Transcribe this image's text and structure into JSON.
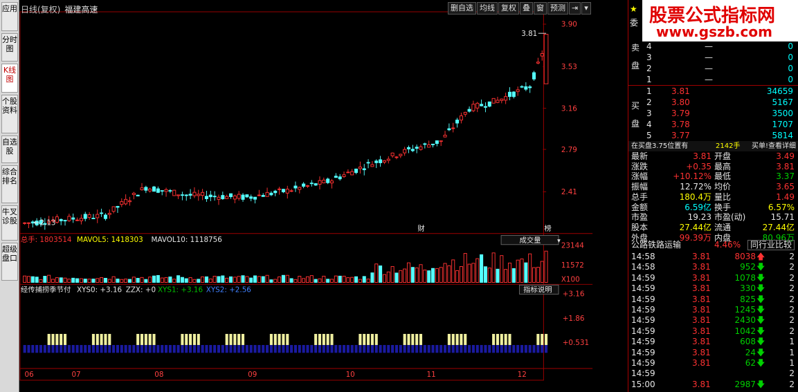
{
  "left_tabs": [
    {
      "label": "应用",
      "active": false
    },
    {
      "label": "分时图",
      "active": false
    },
    {
      "label": "K线图",
      "active": true
    },
    {
      "label": "个股资料",
      "active": false
    },
    {
      "label": "自选股",
      "active": false
    },
    {
      "label": "综合排名",
      "active": false
    },
    {
      "label": "牛叉诊股",
      "active": false
    },
    {
      "label": "超级盘口",
      "active": false
    }
  ],
  "header": {
    "period": "日线(复权)",
    "stock_name": "福建高速",
    "toolbar": [
      "删自选",
      "均线",
      "复权",
      "叠",
      "窗",
      "预测"
    ],
    "arrow_icon": "⇥",
    "menu_icon": "▾"
  },
  "price_chart": {
    "y_ticks": [
      "3.90",
      "3.53",
      "3.16",
      "2.79",
      "2.41"
    ],
    "high_marker": "3.81",
    "low_marker": "2.13",
    "event_labels": [
      "财",
      "榜"
    ]
  },
  "volume_panel": {
    "label_total": "总手: 1803514",
    "label_ma5": "MAVOL5: 1418303",
    "label_ma10": "MAVOL10: 1118756",
    "selector": "成交量",
    "y_ticks": [
      "23144",
      "11572"
    ],
    "unit": "X100"
  },
  "indicator_panel": {
    "name": "经传捕捞季节付",
    "xys0": "XYS0: +3.16",
    "zzx": "ZZX: +0",
    "xys1": "XYS1: +3.16",
    "xys2": "XYS2: +2.56",
    "help_button": "指标说明",
    "y_ticks": [
      "+3.16",
      "+1.86",
      "+0.531"
    ]
  },
  "x_axis": [
    "06",
    "07",
    "08",
    "09",
    "10",
    "11",
    "12"
  ],
  "right_panel": {
    "watermark_line1": "股票公式指标网",
    "watermark_line2": "www.gszb.com",
    "star_icon": "★",
    "commission_label": "委",
    "sell_label": "卖盘",
    "sell_rows": [
      {
        "level": "4",
        "price": "—",
        "vol": "0"
      },
      {
        "level": "3",
        "price": "—",
        "vol": "0"
      },
      {
        "level": "2",
        "price": "—",
        "vol": "0"
      },
      {
        "level": "1",
        "price": "—",
        "vol": "0"
      }
    ],
    "buy_label": "买盘",
    "buy_rows": [
      {
        "level": "1",
        "price": "3.81",
        "vol": "34659"
      },
      {
        "level": "2",
        "price": "3.80",
        "vol": "5167"
      },
      {
        "level": "3",
        "price": "3.79",
        "vol": "3500"
      },
      {
        "level": "4",
        "price": "3.78",
        "vol": "1707"
      },
      {
        "level": "5",
        "price": "3.77",
        "vol": "5814"
      }
    ],
    "buy_note": "在买盘3.75位置有",
    "buy_note_vol": "2142手",
    "buy_note_link": "买单!查看详细",
    "stats": [
      {
        "l1": "最新",
        "v1": "3.81",
        "c1": "red",
        "l2": "开盘",
        "v2": "3.49",
        "c2": "red"
      },
      {
        "l1": "涨跌",
        "v1": "+0.35",
        "c1": "red",
        "l2": "最高",
        "v2": "3.81",
        "c2": "red"
      },
      {
        "l1": "涨幅",
        "v1": "+10.12%",
        "c1": "red",
        "l2": "最低",
        "v2": "3.37",
        "c2": "green"
      },
      {
        "l1": "振幅",
        "v1": "12.72%",
        "c1": "white",
        "l2": "均价",
        "v2": "3.65",
        "c2": "red"
      },
      {
        "l1": "总手",
        "v1": "180.4万",
        "c1": "yellow",
        "l2": "量比",
        "v2": "1.49",
        "c2": "red"
      },
      {
        "l1": "金额",
        "v1": "6.59亿",
        "c1": "cyan",
        "l2": "换手",
        "v2": "6.57%",
        "c2": "yellow"
      },
      {
        "l1": "市盈",
        "v1": "19.23",
        "c1": "white",
        "l2": "市盈(动)",
        "v2": "15.71",
        "c2": "white"
      },
      {
        "l1": "股本",
        "v1": "27.44亿",
        "c1": "yellow",
        "l2": "流通",
        "v2": "27.44亿",
        "c2": "yellow"
      },
      {
        "l1": "外盘",
        "v1": "99.39万",
        "c1": "red",
        "l2": "内盘",
        "v2": "80.96万",
        "c2": "green"
      }
    ],
    "sector_name": "公路铁路运输",
    "sector_change": "4.46%",
    "sector_button": "同行业比较",
    "ticks": [
      {
        "time": "14:58",
        "price": "3.81",
        "vol": "8038",
        "dir": "up",
        "n": "2"
      },
      {
        "time": "14:58",
        "price": "3.81",
        "vol": "952",
        "dir": "down",
        "n": "2"
      },
      {
        "time": "14:59",
        "price": "3.81",
        "vol": "1078",
        "dir": "down",
        "n": "2"
      },
      {
        "time": "14:59",
        "price": "3.81",
        "vol": "330",
        "dir": "down",
        "n": "2"
      },
      {
        "time": "14:59",
        "price": "3.81",
        "vol": "825",
        "dir": "down",
        "n": "2"
      },
      {
        "time": "14:59",
        "price": "3.81",
        "vol": "1245",
        "dir": "down",
        "n": "2"
      },
      {
        "time": "14:59",
        "price": "3.81",
        "vol": "2430",
        "dir": "down",
        "n": "2"
      },
      {
        "time": "14:59",
        "price": "3.81",
        "vol": "1042",
        "dir": "down",
        "n": "2"
      },
      {
        "time": "14:59",
        "price": "3.81",
        "vol": "608",
        "dir": "down",
        "n": "1"
      },
      {
        "time": "14:59",
        "price": "3.81",
        "vol": "24",
        "dir": "down",
        "n": "1"
      },
      {
        "time": "14:59",
        "price": "3.81",
        "vol": "62",
        "dir": "down",
        "n": "1"
      },
      {
        "time": "14:59",
        "price": "",
        "vol": "",
        "dir": "",
        "n": "2"
      },
      {
        "time": "15:00",
        "price": "3.81",
        "vol": "2987",
        "dir": "down",
        "n": "2"
      }
    ]
  }
}
